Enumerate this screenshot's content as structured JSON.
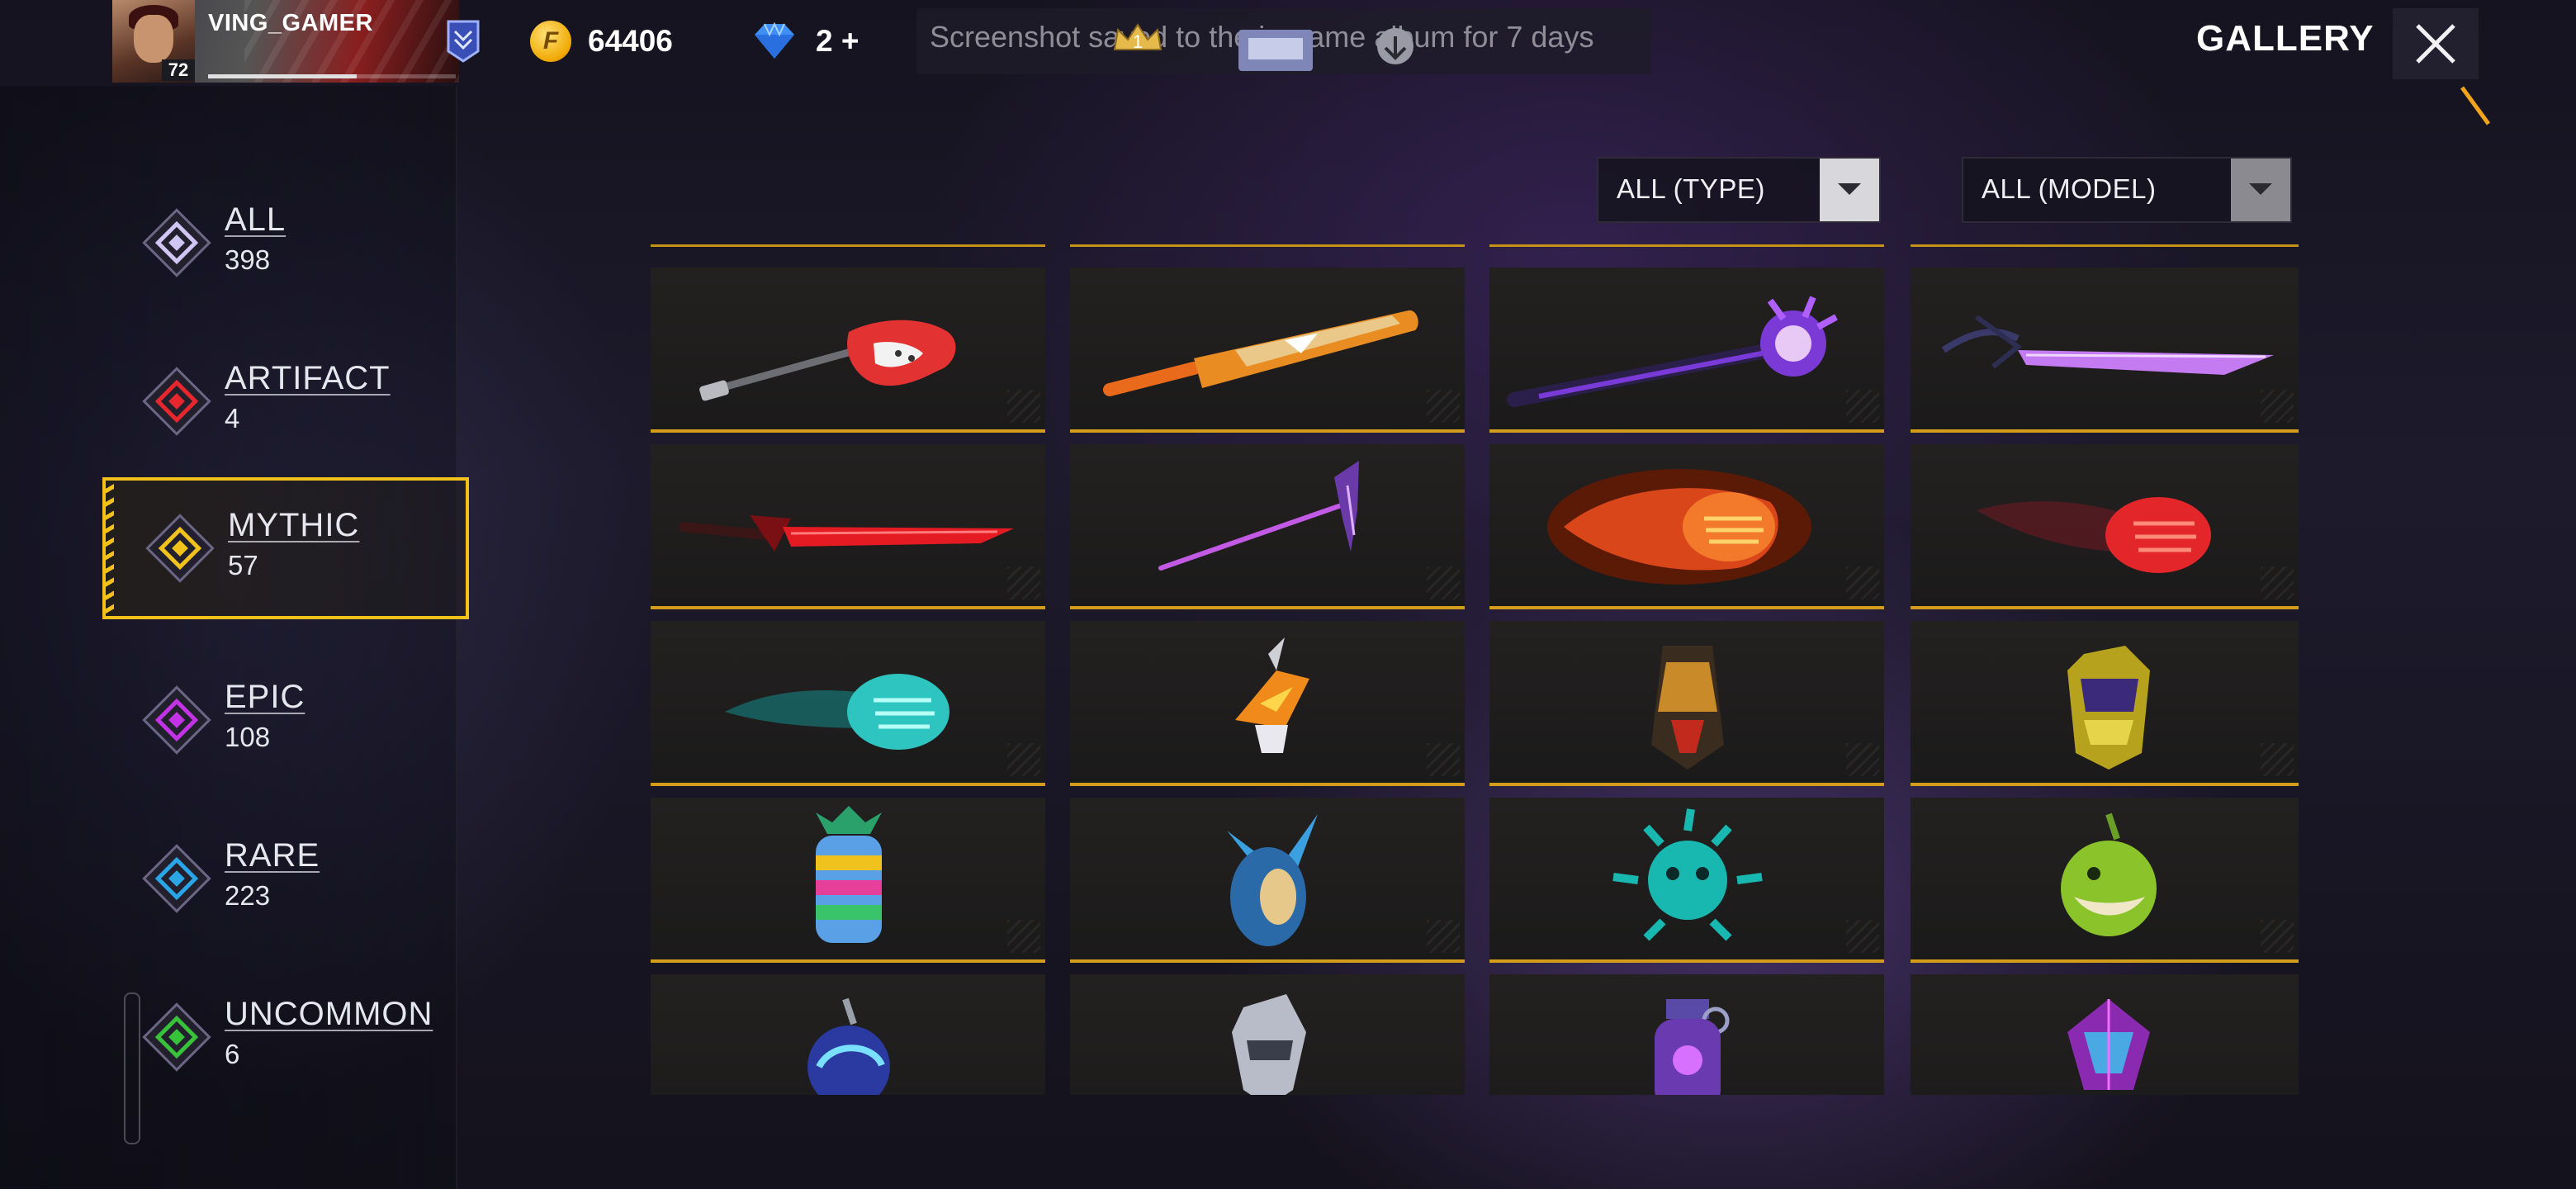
{
  "header": {
    "username": "VING_GAMER",
    "level": "72",
    "gold": "64406",
    "diamonds": "2 +",
    "notice": "Screenshot saved to the in-game album for 7 days",
    "title": "GALLERY"
  },
  "categories": [
    {
      "label": "ALL",
      "count": "398",
      "color": "#cfc6f4",
      "selected": false
    },
    {
      "label": "ARTIFACT",
      "count": "4",
      "color": "#e8262e",
      "selected": false
    },
    {
      "label": "MYTHIC",
      "count": "57",
      "color": "#f1c21b",
      "selected": true
    },
    {
      "label": "EPIC",
      "count": "108",
      "color": "#c333e6",
      "selected": false
    },
    {
      "label": "RARE",
      "count": "223",
      "color": "#2aa6e6",
      "selected": false
    },
    {
      "label": "UNCOMMON",
      "count": "6",
      "color": "#38c23a",
      "selected": false
    }
  ],
  "filters": {
    "type": "ALL (TYPE)",
    "model": "ALL (MODEL)"
  },
  "items": [
    {
      "icon": "electric-guitar-icon"
    },
    {
      "icon": "cricket-bat-icon"
    },
    {
      "icon": "purple-mace-icon"
    },
    {
      "icon": "violet-katana-icon"
    },
    {
      "icon": "crimson-sword-icon"
    },
    {
      "icon": "purple-scythe-icon"
    },
    {
      "icon": "flaming-fist-icon"
    },
    {
      "icon": "red-fist-icon"
    },
    {
      "icon": "teal-fist-icon"
    },
    {
      "icon": "lightning-grenade-icon"
    },
    {
      "icon": "tribal-mask-grenade-icon"
    },
    {
      "icon": "yellow-armor-grenade-icon"
    },
    {
      "icon": "rainbow-pineapple-grenade-icon"
    },
    {
      "icon": "horned-helmet-grenade-icon"
    },
    {
      "icon": "spiked-cyan-grenade-icon"
    },
    {
      "icon": "green-frog-grenade-icon"
    },
    {
      "icon": "blue-bomb-grenade-icon"
    },
    {
      "icon": "silver-helm-grenade-icon"
    },
    {
      "icon": "purple-frag-grenade-icon"
    },
    {
      "icon": "crystal-cube-grenade-icon"
    }
  ],
  "colors": {
    "accent": "#f2c21a",
    "card_border": "#d39d1b"
  }
}
